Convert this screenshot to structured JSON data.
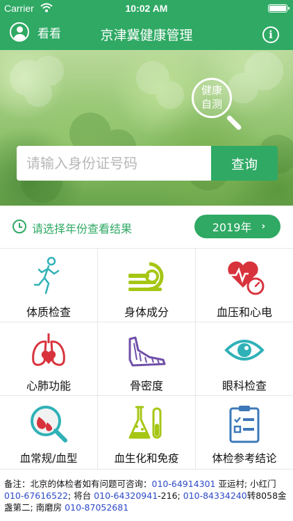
{
  "status_bar": {
    "carrier": "Carrier",
    "time": "10:02 AM"
  },
  "nav": {
    "user_label": "看看",
    "title": "京津冀健康管理",
    "info_glyph": "i"
  },
  "hero": {
    "badge_text": "健康\n自测"
  },
  "search": {
    "placeholder": "请输入身份证号码",
    "button_label": "查询"
  },
  "year_selector": {
    "hint": "请选择年份查看结果",
    "selected_year": "2019年"
  },
  "grid": {
    "items": [
      {
        "label": "体质检查",
        "icon": "runner-icon"
      },
      {
        "label": "身体成分",
        "icon": "body-scanner-icon"
      },
      {
        "label": "血压和心电",
        "icon": "heart-gauge-icon"
      },
      {
        "label": "心肺功能",
        "icon": "lungs-heart-icon"
      },
      {
        "label": "骨密度",
        "icon": "foot-bone-icon"
      },
      {
        "label": "眼科检查",
        "icon": "eye-icon"
      },
      {
        "label": "血常规/血型",
        "icon": "blood-drop-magnifier-icon"
      },
      {
        "label": "血生化和免疫",
        "icon": "lab-flask-icon"
      },
      {
        "label": "体检参考结论",
        "icon": "clipboard-checklist-icon"
      }
    ]
  },
  "footer": {
    "t1": "备注：北京的体检者如有问题可咨询：",
    "p1": "010-64914301",
    "t2": " 亚运村; 小红门 ",
    "p2": "010-67616522",
    "t3": "; 将台 ",
    "p3": "010-64320941",
    "t4": "-216; ",
    "p4": "010-84334240",
    "t5": "转8058金盏第二; 南磨房 ",
    "p5": "010-87052681"
  },
  "colors": {
    "brand_green": "#2fa964",
    "phone_blue": "#2c49c8",
    "icon_red": "#d8333d",
    "icon_teal": "#2fb1b7"
  }
}
